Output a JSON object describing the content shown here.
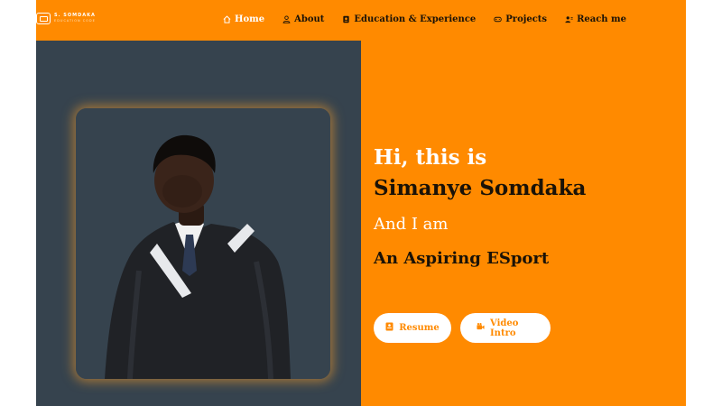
{
  "brand": {
    "name": "S. SOMDAKA",
    "tagline": "EDUCATION CODE"
  },
  "nav": [
    {
      "label": "Home",
      "icon": "home-icon",
      "active": true
    },
    {
      "label": "About",
      "icon": "user-icon",
      "active": false
    },
    {
      "label": "Education & Experience",
      "icon": "certificate-icon",
      "active": false
    },
    {
      "label": "Projects",
      "icon": "gamepad-icon",
      "active": false
    },
    {
      "label": "Reach me",
      "icon": "contact-icon",
      "active": false
    }
  ],
  "hero": {
    "greeting": "Hi, this is",
    "name": "Simanye Somdaka",
    "and_i_am": "And I am",
    "role": "An Aspiring ESport"
  },
  "buttons": {
    "resume": "Resume",
    "video": "Video Intro"
  },
  "colors": {
    "accent": "#ff8a00",
    "panel": "#36434e",
    "dark_text": "#1a1207",
    "white": "#ffffff"
  }
}
